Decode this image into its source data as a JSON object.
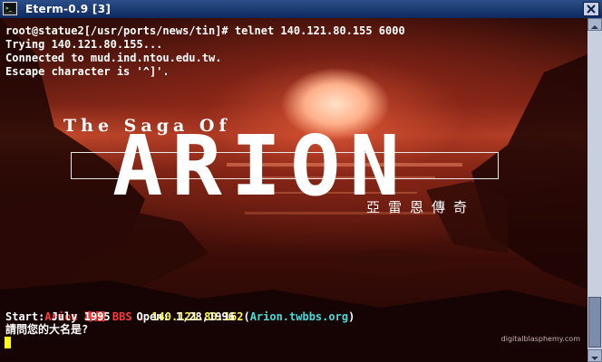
{
  "window": {
    "title": "Eterm-0.9  [3]",
    "icon": "terminal-app-icon",
    "close_icon": "close-x-icon"
  },
  "terminal": {
    "lines": [
      {
        "text": "root@statue2[/usr/ports/news/tin]# telnet 140.121.80.155 6000"
      },
      {
        "text": "Trying 140.121.80.155..."
      },
      {
        "text": "Connected to mud.ind.ntou.edu.tw."
      },
      {
        "text": "Escape character is '^]'."
      }
    ],
    "logo": {
      "title": "The Saga Of",
      "big": "ARION",
      "chinese": "亞雷恩傳奇"
    },
    "bbs_name": "Arion 專屬 BBS :",
    "bbs_ip": "140.121.80.162",
    "bbs_paren_open": "(",
    "bbs_host": "Arion.twbbs.org",
    "bbs_paren_close": ")",
    "start_line": "Start: July 1995    Open: 1,28,1996",
    "prompt": "請問您的大名是?",
    "watermark": "digitalblasphemy.com"
  },
  "colors": {
    "titlebar": "#1a3a78",
    "bbs_name": "#ff3a3a",
    "bbs_ip": "#ffff44",
    "bbs_host": "#44dddd",
    "cursor": "#ffff00"
  }
}
